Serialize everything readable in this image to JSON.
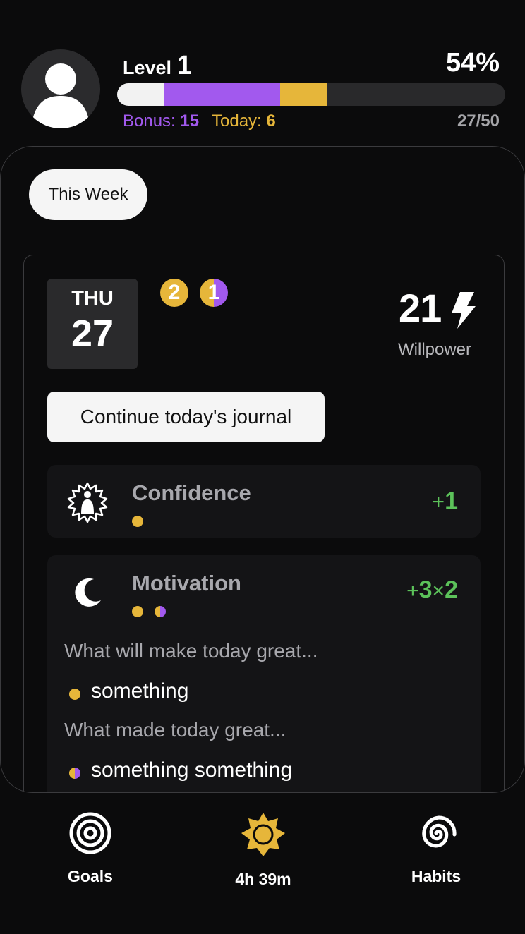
{
  "header": {
    "level_label": "Level",
    "level_value": "1",
    "percent": "54%",
    "progress_segments": [
      {
        "name": "earned",
        "fraction": 0.12,
        "color": "#f2f2f2"
      },
      {
        "name": "bonus",
        "fraction": 0.3,
        "color": "#a259ee"
      },
      {
        "name": "today",
        "fraction": 0.12,
        "color": "#e6b63a"
      }
    ],
    "bonus_label": "Bonus:",
    "bonus_value": "15",
    "today_label": "Today:",
    "today_value": "6",
    "ratio": "27/50"
  },
  "panel": {
    "week_label": "This Week",
    "day": {
      "dow": "THU",
      "date": "27",
      "tokens": [
        "2",
        "1"
      ],
      "willpower_value": "21",
      "willpower_label": "Willpower",
      "journal_button": "Continue today's journal"
    },
    "items": [
      {
        "title": "Confidence",
        "delta_sign": "+",
        "delta_value": "1",
        "icon": "confidence-figure-icon"
      },
      {
        "title": "Motivation",
        "delta_sign": "+",
        "delta_value": "3",
        "multiplier_sign": "×",
        "multiplier_value": "2",
        "icon": "moon-icon",
        "prompt_1": "What will make today great...",
        "entry_1": "something",
        "prompt_2": "What made today great...",
        "entry_2": "something something"
      }
    ]
  },
  "nav": [
    {
      "label": "Goals",
      "icon": "target-icon"
    },
    {
      "label": "4h 39m",
      "icon": "sun-icon"
    },
    {
      "label": "Habits",
      "icon": "spiral-icon"
    }
  ],
  "colors": {
    "purple": "#a259ee",
    "yellow": "#e6b63a",
    "green": "#5cc25a",
    "background": "#0b0b0c"
  }
}
